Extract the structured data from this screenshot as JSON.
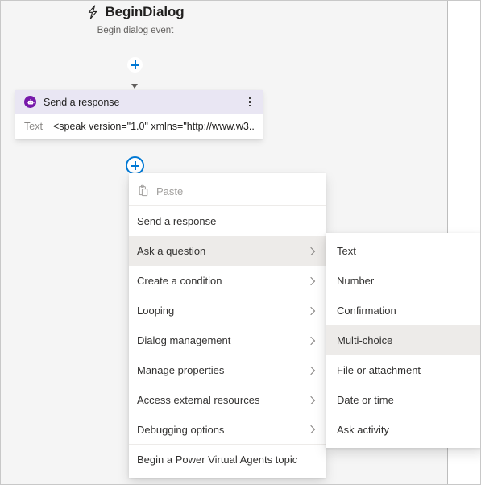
{
  "canvas": {
    "background_color": "#f5f5f5",
    "panel_color": "#ffffff"
  },
  "trigger": {
    "icon": "lightning-bolt-icon",
    "title": "BeginDialog",
    "subtitle": "Begin dialog event"
  },
  "connectors": {
    "add_node_top": {
      "icon": "plus-icon",
      "state": "normal"
    },
    "add_node_bottom": {
      "icon": "plus-icon",
      "state": "selected",
      "ring_color": "#0078d4"
    }
  },
  "card": {
    "icon": "send-response-icon",
    "icon_color": "#7719aa",
    "header_color": "#e9e6f3",
    "title": "Send a response",
    "overflow_icon": "kebab-menu-icon",
    "field_label": "Text",
    "field_value": "<speak version=\"1.0\" xmlns=\"http://www.w3...."
  },
  "menu": {
    "items": [
      {
        "label": "Paste",
        "icon": "clipboard-paste-icon",
        "disabled": true,
        "submenu": false,
        "highlight": false,
        "separator_below": true
      },
      {
        "label": "Send a response",
        "icon": null,
        "disabled": false,
        "submenu": false,
        "highlight": false,
        "separator_below": false
      },
      {
        "label": "Ask a question",
        "icon": null,
        "disabled": false,
        "submenu": true,
        "highlight": true,
        "separator_below": false
      },
      {
        "label": "Create a condition",
        "icon": null,
        "disabled": false,
        "submenu": true,
        "highlight": false,
        "separator_below": false
      },
      {
        "label": "Looping",
        "icon": null,
        "disabled": false,
        "submenu": true,
        "highlight": false,
        "separator_below": false
      },
      {
        "label": "Dialog management",
        "icon": null,
        "disabled": false,
        "submenu": true,
        "highlight": false,
        "separator_below": false
      },
      {
        "label": "Manage properties",
        "icon": null,
        "disabled": false,
        "submenu": true,
        "highlight": false,
        "separator_below": false
      },
      {
        "label": "Access external resources",
        "icon": null,
        "disabled": false,
        "submenu": true,
        "highlight": false,
        "separator_below": false
      },
      {
        "label": "Debugging options",
        "icon": null,
        "disabled": false,
        "submenu": true,
        "highlight": false,
        "separator_below": true
      },
      {
        "label": "Begin a Power Virtual Agents topic",
        "icon": null,
        "disabled": false,
        "submenu": false,
        "highlight": false,
        "separator_below": false
      }
    ]
  },
  "submenu": {
    "parent": "Ask a question",
    "items": [
      {
        "label": "Text",
        "highlight": false
      },
      {
        "label": "Number",
        "highlight": false
      },
      {
        "label": "Confirmation",
        "highlight": false
      },
      {
        "label": "Multi-choice",
        "highlight": true
      },
      {
        "label": "File or attachment",
        "highlight": false
      },
      {
        "label": "Date or time",
        "highlight": false
      },
      {
        "label": "Ask activity",
        "highlight": false
      }
    ]
  }
}
